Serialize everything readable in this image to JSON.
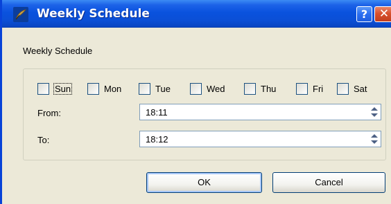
{
  "window": {
    "title": "Weekly Schedule",
    "title_icon": "app-feather-icon",
    "help_label": "?",
    "close_label": "✕"
  },
  "heading": "Weekly Schedule",
  "days": [
    {
      "label": "Sun",
      "checked": false,
      "focused": true
    },
    {
      "label": "Mon",
      "checked": false,
      "focused": false
    },
    {
      "label": "Tue",
      "checked": false,
      "focused": false
    },
    {
      "label": "Wed",
      "checked": false,
      "focused": false
    },
    {
      "label": "Thu",
      "checked": false,
      "focused": false
    },
    {
      "label": "Fri",
      "checked": false,
      "focused": false
    },
    {
      "label": "Sat",
      "checked": false,
      "focused": false
    }
  ],
  "from": {
    "label": "From:",
    "value": "18:11"
  },
  "to": {
    "label": "To:",
    "value": "18:12"
  },
  "buttons": {
    "ok": "OK",
    "cancel": "Cancel"
  },
  "colors": {
    "titlebar": "#0a52de",
    "close_button": "#d8502e",
    "dialog_bg": "#ece9d8",
    "input_border": "#7f9db9"
  }
}
